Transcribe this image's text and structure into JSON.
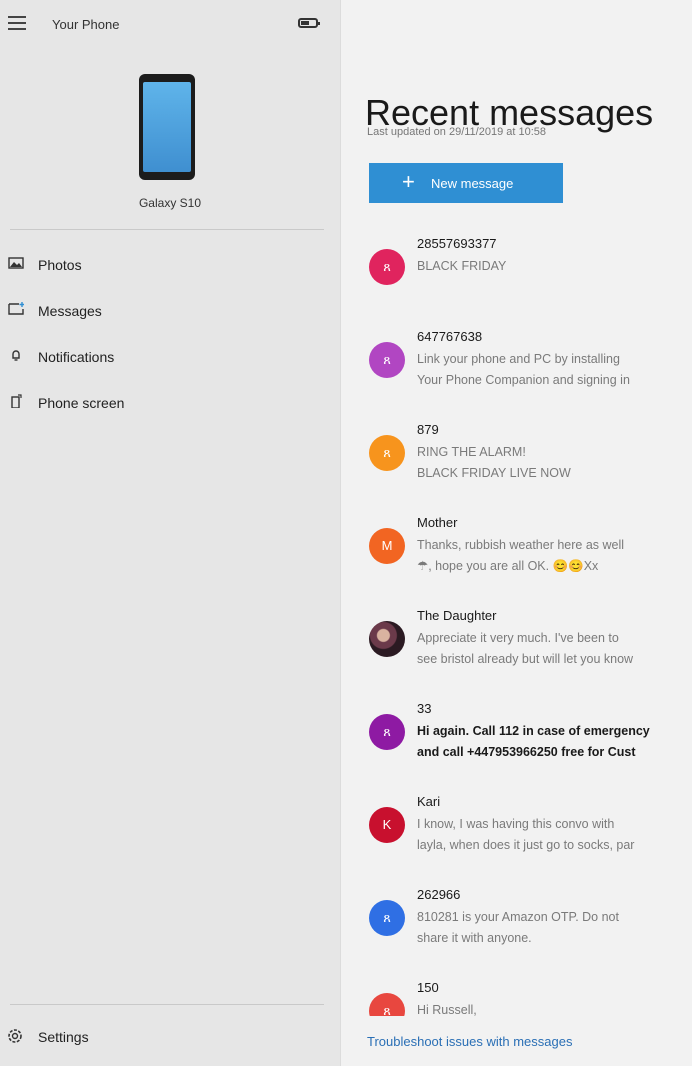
{
  "app": {
    "title": "Your Phone"
  },
  "device": {
    "name": "Galaxy S10"
  },
  "nav": {
    "items": [
      {
        "label": "Photos",
        "icon": "photos-icon"
      },
      {
        "label": "Messages",
        "icon": "messages-icon"
      },
      {
        "label": "Notifications",
        "icon": "notifications-icon"
      },
      {
        "label": "Phone screen",
        "icon": "phone-screen-icon"
      }
    ],
    "settings_label": "Settings"
  },
  "main": {
    "title": "Recent messages",
    "last_updated": "Last updated on 29/11/2019 at 10:58",
    "new_message_label": "New message",
    "new_message_icon": "+",
    "troubleshoot_link": "Troubleshoot issues with messages"
  },
  "messages": [
    {
      "sender": "28557693377",
      "preview": "BLACK FRIDAY",
      "avatar": "person-icon",
      "avatar_text": "ጸ",
      "color": "#e0245e",
      "unread": false
    },
    {
      "sender": "647767638",
      "preview": "Link your phone and PC by installing\nYour Phone Companion and signing in",
      "avatar": "person-icon",
      "avatar_text": "ጸ",
      "color": "#b146c2",
      "unread": false
    },
    {
      "sender": "879",
      "preview": "RING THE ALARM!\nBLACK FRIDAY LIVE NOW",
      "avatar": "person-icon",
      "avatar_text": "ጸ",
      "color": "#f7941d",
      "unread": false
    },
    {
      "sender": "Mother",
      "preview": "Thanks, rubbish weather here as well\n☂, hope you are all OK. 😊😊Xx",
      "avatar": "initial",
      "avatar_text": "M",
      "color": "#f26522",
      "unread": false
    },
    {
      "sender": "The Daughter",
      "preview": "Appreciate it very much. I've been to\nsee bristol already but will let you know",
      "avatar": "photo",
      "avatar_text": "",
      "color": "#6b3a4a",
      "unread": false
    },
    {
      "sender": "33",
      "preview": "Hi again. Call 112 in case of emergency\nand call +447953966250 free for Cust",
      "avatar": "person-icon",
      "avatar_text": "ጸ",
      "color": "#8e1aa3",
      "unread": true
    },
    {
      "sender": "Kari",
      "preview": "I know, I was having this convo with\nlayla, when does it just go to socks, par",
      "avatar": "initial",
      "avatar_text": "K",
      "color": "#c8102e",
      "unread": false
    },
    {
      "sender": "262966",
      "preview": "810281 is your Amazon OTP. Do not\nshare it with anyone.",
      "avatar": "person-icon",
      "avatar_text": "ጸ",
      "color": "#2f6fe4",
      "unread": false
    },
    {
      "sender": "150",
      "preview": "Hi Russell,",
      "avatar": "person-icon",
      "avatar_text": "ጸ",
      "color": "#e8473f",
      "unread": false
    }
  ]
}
